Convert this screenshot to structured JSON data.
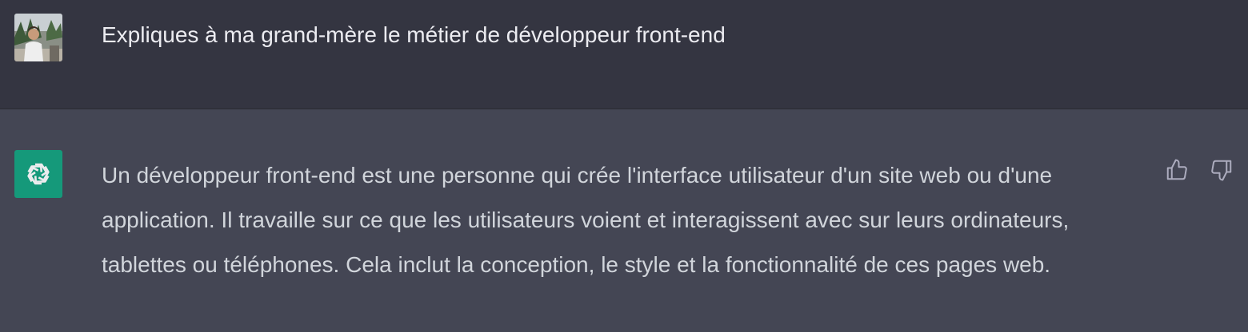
{
  "conversation": {
    "user_message": {
      "avatar": "user-photo-avatar",
      "text": "Expliques à ma grand-mère le métier de développeur front-end"
    },
    "assistant_message": {
      "avatar": "openai-logo-icon",
      "text": "Un développeur front-end est une personne qui crée l'interface utilisateur d'un site web ou d'une application. Il travaille sur ce que les utilisateurs voient et interagissent avec sur leurs ordinateurs, tablettes ou téléphones. Cela inclut la conception, le style et la fonctionnalité de ces pages web.",
      "feedback": {
        "like_icon": "thumbs-up-icon",
        "dislike_icon": "thumbs-down-icon"
      }
    }
  },
  "colors": {
    "user_row_bg": "#343541",
    "assistant_row_bg": "#444654",
    "bot_avatar_bg": "#10a37f",
    "user_text": "#ececf1",
    "assistant_text": "#d1d5db"
  }
}
